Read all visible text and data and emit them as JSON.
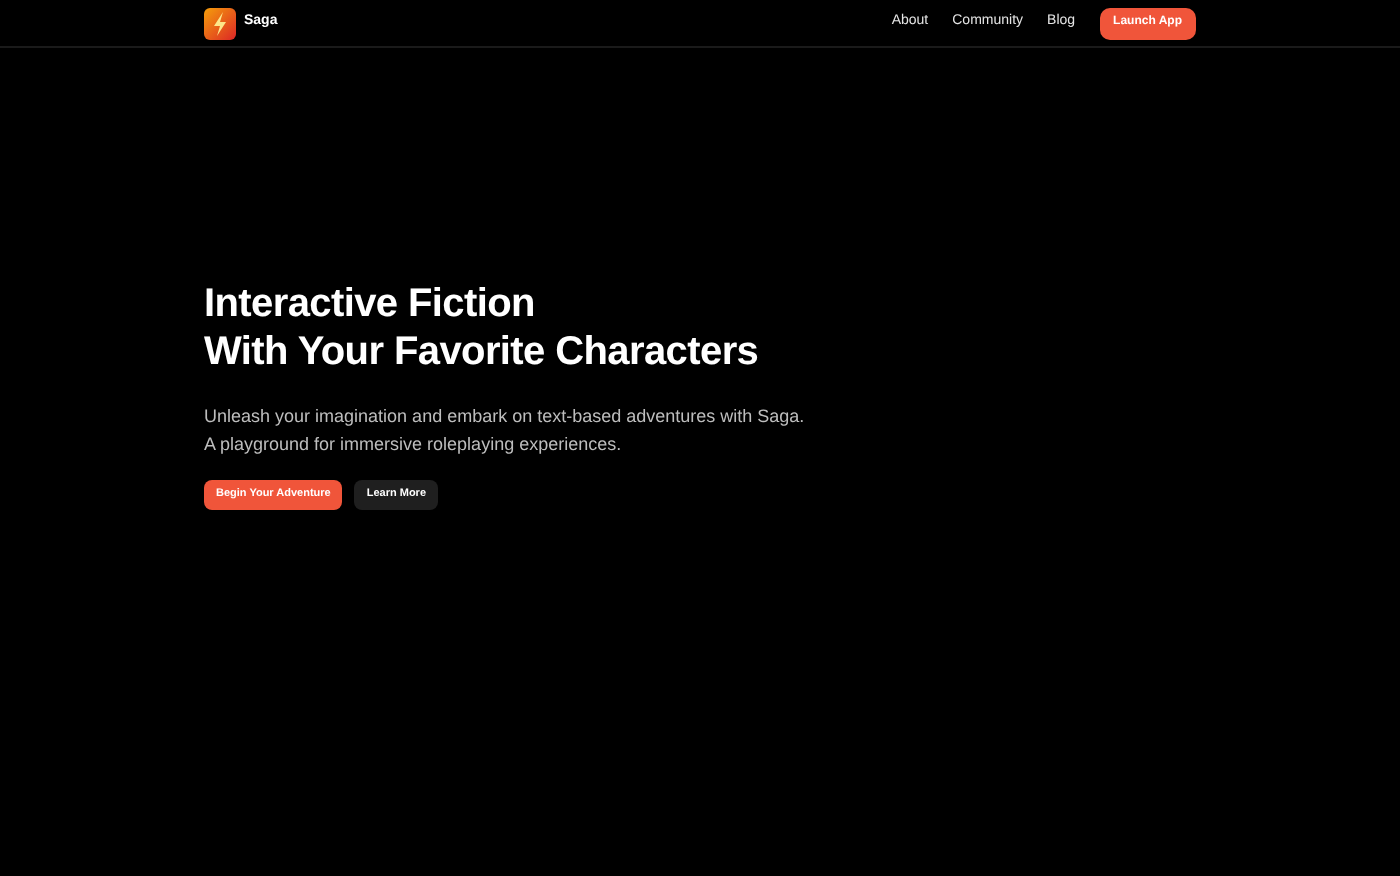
{
  "header": {
    "brand": "Saga",
    "nav": [
      {
        "label": "About",
        "kind": "link"
      },
      {
        "label": "Community",
        "kind": "link"
      },
      {
        "label": "Blog",
        "kind": "link"
      },
      {
        "label": "Launch App",
        "kind": "button"
      }
    ]
  },
  "hero": {
    "title_lines": [
      "Interactive Fiction",
      "With Your Favorite Characters"
    ],
    "description_lines": [
      "Unleash your imagination and embark on text-based adventures with Saga.",
      "A playground for immersive roleplaying experiences."
    ],
    "buttons": [
      {
        "label": "Begin Your Adventure",
        "kind": "primary"
      },
      {
        "label": "Learn More",
        "kind": "secondary"
      }
    ]
  }
}
